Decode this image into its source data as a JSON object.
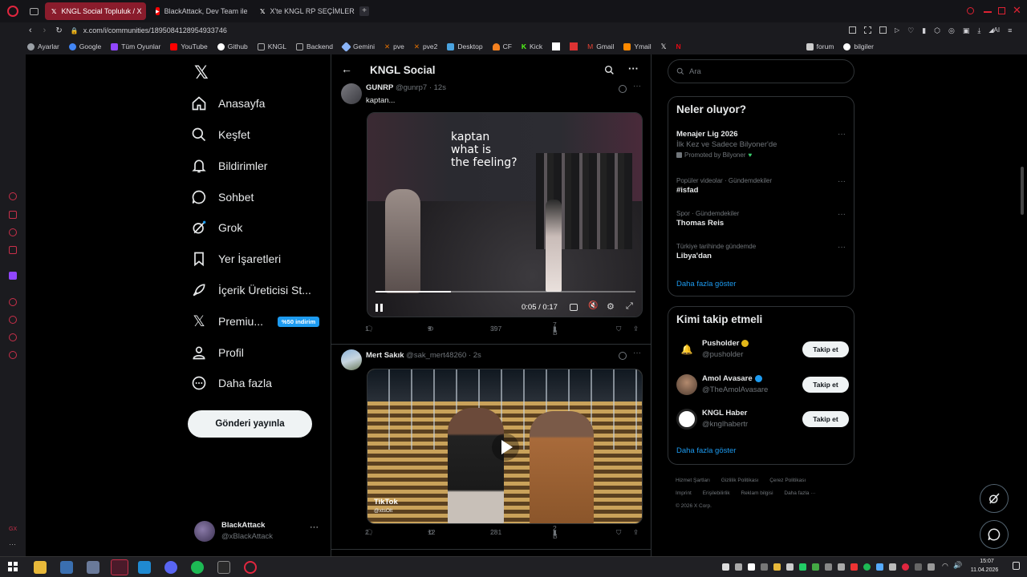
{
  "browser": {
    "tabs": [
      {
        "label": "KNGL Social Topluluk / X",
        "icon": "x-logo-icon"
      },
      {
        "label": "BlackAttack, Dev Team ile",
        "icon": "youtube-icon"
      },
      {
        "label": "X'te KNGL RP SEÇİMLERİ:",
        "icon": "x-logo-icon"
      }
    ],
    "url": "x.com/i/communities/1895084128954933746",
    "bookmarks": [
      {
        "label": "Ayarlar",
        "color": "#9aa0a6"
      },
      {
        "label": "Google",
        "color": "#4285f4"
      },
      {
        "label": "Tüm Oyunlar",
        "color": "#9146ff"
      },
      {
        "label": "YouTube",
        "color": "#ff0000"
      },
      {
        "label": "Github",
        "color": "#ffffff"
      },
      {
        "label": "KNGL",
        "color": "#9aa0a6"
      },
      {
        "label": "Backend",
        "color": "#9aa0a6"
      },
      {
        "label": "Gemini",
        "color": "#8ab4f8"
      },
      {
        "label": "pve",
        "color": "#e57000"
      },
      {
        "label": "pve2",
        "color": "#e57000"
      },
      {
        "label": "Desktop",
        "color": "#4aa3df"
      },
      {
        "label": "CF",
        "color": "#f48120"
      },
      {
        "label": "Kick",
        "color": "#53fc18"
      },
      {
        "label": "Gmail",
        "color": "#ea4335"
      },
      {
        "label": "Ymail",
        "color": "#ff8a00"
      },
      {
        "label": "forum",
        "color": "#9aa0a6"
      },
      {
        "label": "bilgiler",
        "color": "#ffffff"
      }
    ]
  },
  "sidebar": {
    "items": [
      {
        "label": "Anasayfa",
        "icon": "home-icon"
      },
      {
        "label": "Keşfet",
        "icon": "search-icon"
      },
      {
        "label": "Bildirimler",
        "icon": "bell-icon"
      },
      {
        "label": "Sohbet",
        "icon": "chat-icon"
      },
      {
        "label": "Grok",
        "icon": "grok-icon"
      },
      {
        "label": "Yer İşaretleri",
        "icon": "bookmark-icon"
      },
      {
        "label": "İçerik Üreticisi St...",
        "icon": "rocket-icon"
      },
      {
        "label": "Premiu...",
        "icon": "x-logo-icon"
      },
      {
        "label": "Profil",
        "icon": "person-icon"
      },
      {
        "label": "Daha fazla",
        "icon": "more-circle-icon"
      }
    ],
    "premium_badge": "%50 indirim",
    "post_button": "Gönderi yayınla",
    "account": {
      "name": "BlackAttack",
      "handle": "@xBlackAttack"
    }
  },
  "main": {
    "title": "KNGL Social",
    "tweets": [
      {
        "name": "GUNRP",
        "handle": "@gunrp7",
        "time": "12s",
        "text": "kaptan...",
        "video_caption": "kaptan\nwhat is\nthe feeling?",
        "video_time": "0:05 / 0:17",
        "video_progress": 0.29,
        "replies": "1",
        "reposts": "9",
        "likes": "397",
        "views": "7 B"
      },
      {
        "name": "Mert Sakık",
        "handle": "@sak_mert48260",
        "time": "2s",
        "text": "",
        "video_watermark": "TikTok",
        "video_watermark_sub": "@xtsOlt",
        "replies": "2",
        "reposts": "12",
        "likes": "281",
        "views": "2 B"
      }
    ]
  },
  "right": {
    "search_placeholder": "Ara",
    "trends_title": "Neler oluyor?",
    "trends": [
      {
        "meta": "",
        "name": "Menajer Lig 2026",
        "sub": "İlk Kez ve Sadece Bilyoner'de",
        "promo": "Promoted by Bilyoner"
      },
      {
        "meta": "Popüler videolar · Gündemdekiler",
        "name": "#isfad"
      },
      {
        "meta": "Spor · Gündemdekiler",
        "name": "Thomas Reis"
      },
      {
        "meta": "Türkiye tarihinde gündemde",
        "name": "Libya'dan"
      }
    ],
    "trends_more": "Daha fazla göster",
    "who_title": "Kimi takip etmeli",
    "who": [
      {
        "name": "Pusholder",
        "handle": "@pusholder",
        "verified": "gold"
      },
      {
        "name": "Amol Avasare",
        "handle": "@TheAmolAvasare",
        "verified": "blue"
      },
      {
        "name": "KNGL Haber",
        "handle": "@knglhabertr",
        "verified": ""
      }
    ],
    "follow_label": "Takip et",
    "who_more": "Daha fazla göster",
    "footer": [
      "Hizmet Şartları",
      "Gizlilik Politikası",
      "Çerez Politikası",
      "Imprint",
      "Erişilebilirlik",
      "Reklam bilgisi",
      "Daha fazla ···",
      "© 2026 X Corp."
    ]
  },
  "taskbar": {
    "time": "15:07",
    "date": "11.04.2026"
  }
}
